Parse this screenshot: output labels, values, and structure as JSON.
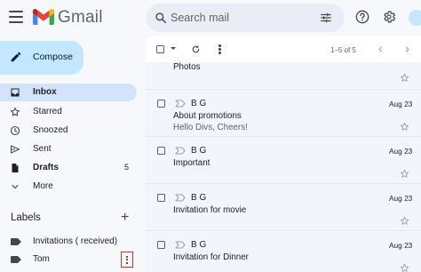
{
  "app": {
    "name": "Gmail"
  },
  "search": {
    "placeholder": "Search mail"
  },
  "compose": {
    "label": "Compose"
  },
  "sidebar": {
    "items": [
      {
        "label": "Inbox",
        "count": ""
      },
      {
        "label": "Starred",
        "count": ""
      },
      {
        "label": "Snoozed",
        "count": ""
      },
      {
        "label": "Sent",
        "count": ""
      },
      {
        "label": "Drafts",
        "count": "5"
      },
      {
        "label": "More",
        "count": ""
      }
    ]
  },
  "labels": {
    "heading": "Labels",
    "items": [
      {
        "name": "Invitations ( received)"
      },
      {
        "name": "Tom"
      }
    ]
  },
  "toolbar": {
    "pagination": "1–5 of 5"
  },
  "emails": {
    "partial_subject": "Photos",
    "rows": [
      {
        "from": "B G",
        "subject": "About promotions",
        "snippet": "Hello Divs, Cheers!",
        "date": "Aug 23"
      },
      {
        "from": "B G",
        "subject": "Important",
        "snippet": "",
        "date": "Aug 23"
      },
      {
        "from": "B G",
        "subject": "Invitation for movie",
        "snippet": "",
        "date": "Aug 23"
      },
      {
        "from": "B G",
        "subject": "Invitation for Dinner",
        "snippet": "",
        "date": "Aug 23"
      }
    ]
  },
  "colors": {
    "accent": "#c2e7ff",
    "active_nav": "#d3e3fd",
    "highlight_box": "#d93025"
  }
}
